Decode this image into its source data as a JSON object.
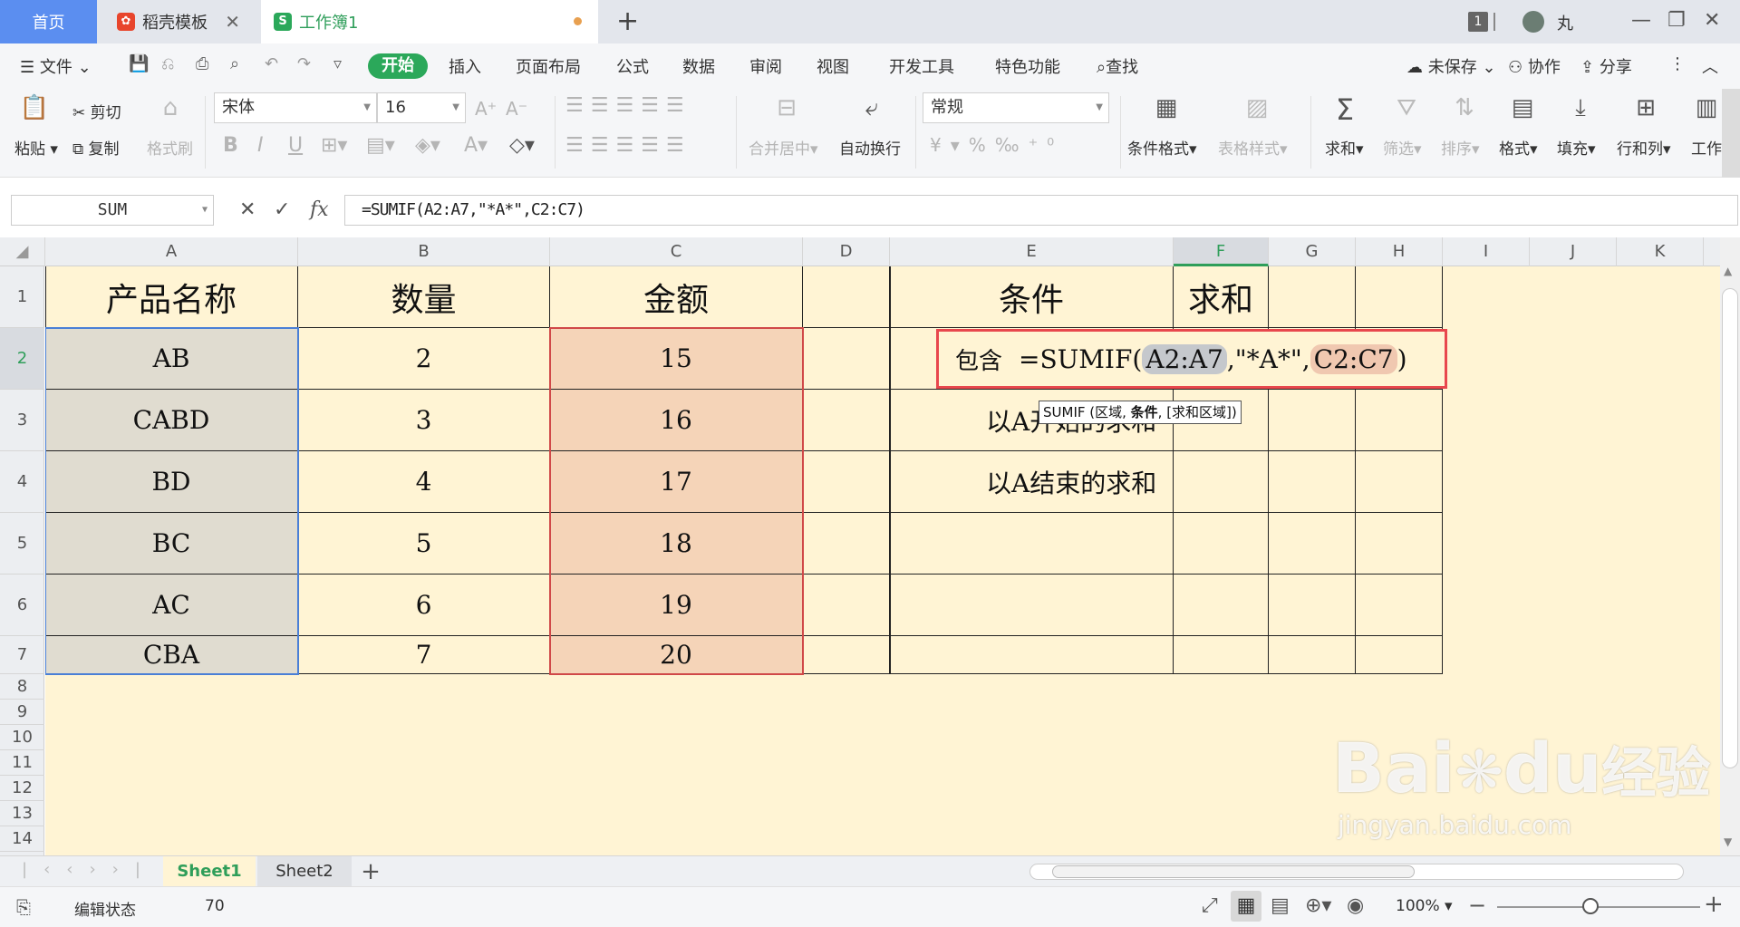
{
  "tabs": [
    {
      "label": "首页"
    },
    {
      "label": "稻壳模板"
    },
    {
      "label": "工作簿1"
    }
  ],
  "window": {
    "badge": "1",
    "user": "丸"
  },
  "menu": {
    "file": "文件",
    "items": [
      "开始",
      "插入",
      "页面布局",
      "公式",
      "数据",
      "审阅",
      "视图",
      "开发工具",
      "特色功能",
      "查找"
    ],
    "unsaved": "未保存",
    "collab": "协作",
    "share": "分享"
  },
  "ribbon": {
    "paste": "粘贴",
    "cut": "剪切",
    "copy": "复制",
    "format_painter": "格式刷",
    "font_name": "宋体",
    "font_size": "16",
    "merge_center": "合并居中",
    "wrap_text": "自动换行",
    "number_format": "常规",
    "conditional_format": "条件格式",
    "table_style": "表格样式",
    "sum": "求和",
    "filter": "筛选",
    "sort": "排序",
    "format": "格式",
    "fill": "填充",
    "row_col": "行和列",
    "worksheet": "工作"
  },
  "formula_bar": {
    "name_box": "SUM",
    "formula": "=SUMIF(A2:A7,\"*A*\",C2:C7)"
  },
  "columns": [
    "A",
    "B",
    "C",
    "D",
    "E",
    "F",
    "G",
    "H",
    "I",
    "J",
    "K"
  ],
  "rows": [
    "1",
    "2",
    "3",
    "4",
    "5",
    "6",
    "7",
    "8",
    "9",
    "10",
    "11",
    "12",
    "13",
    "14"
  ],
  "sheet": {
    "header": {
      "a": "产品名称",
      "b": "数量",
      "c": "金额",
      "e": "条件",
      "f": "求和"
    },
    "data": [
      {
        "a": "AB",
        "b": "2",
        "c": "15"
      },
      {
        "a": "CABD",
        "b": "3",
        "c": "16"
      },
      {
        "a": "BD",
        "b": "4",
        "c": "17"
      },
      {
        "a": "BC",
        "b": "5",
        "c": "18"
      },
      {
        "a": "AC",
        "b": "6",
        "c": "19"
      },
      {
        "a": "CBA",
        "b": "7",
        "c": "20"
      }
    ],
    "e3": "以A开始的求和",
    "e4": "以A结束的求和"
  },
  "overlay": {
    "prefix": "包含",
    "fn": "=SUMIF(",
    "range1": "A2:A7",
    "crit": ",\"*A*\",",
    "range2": "C2:C7",
    "close": ")",
    "tooltip_pre": "SUMIF (区域, ",
    "tooltip_bold": "条件",
    "tooltip_post": ", [求和区域])"
  },
  "sheets": [
    "Sheet1",
    "Sheet2"
  ],
  "status": {
    "mode": "编辑状态",
    "value": "70",
    "zoom": "100%"
  },
  "watermark": {
    "logo": "Bai",
    "logo2": "du",
    "cn": "经验",
    "url": "jingyan.baidu.com"
  },
  "colors": {
    "accent": "#2ba85a",
    "sheet_bg": "#fff4d4",
    "range_a": "#e0dcd0",
    "range_c": "#f5d4b8",
    "highlight_box": "#e8474d"
  }
}
